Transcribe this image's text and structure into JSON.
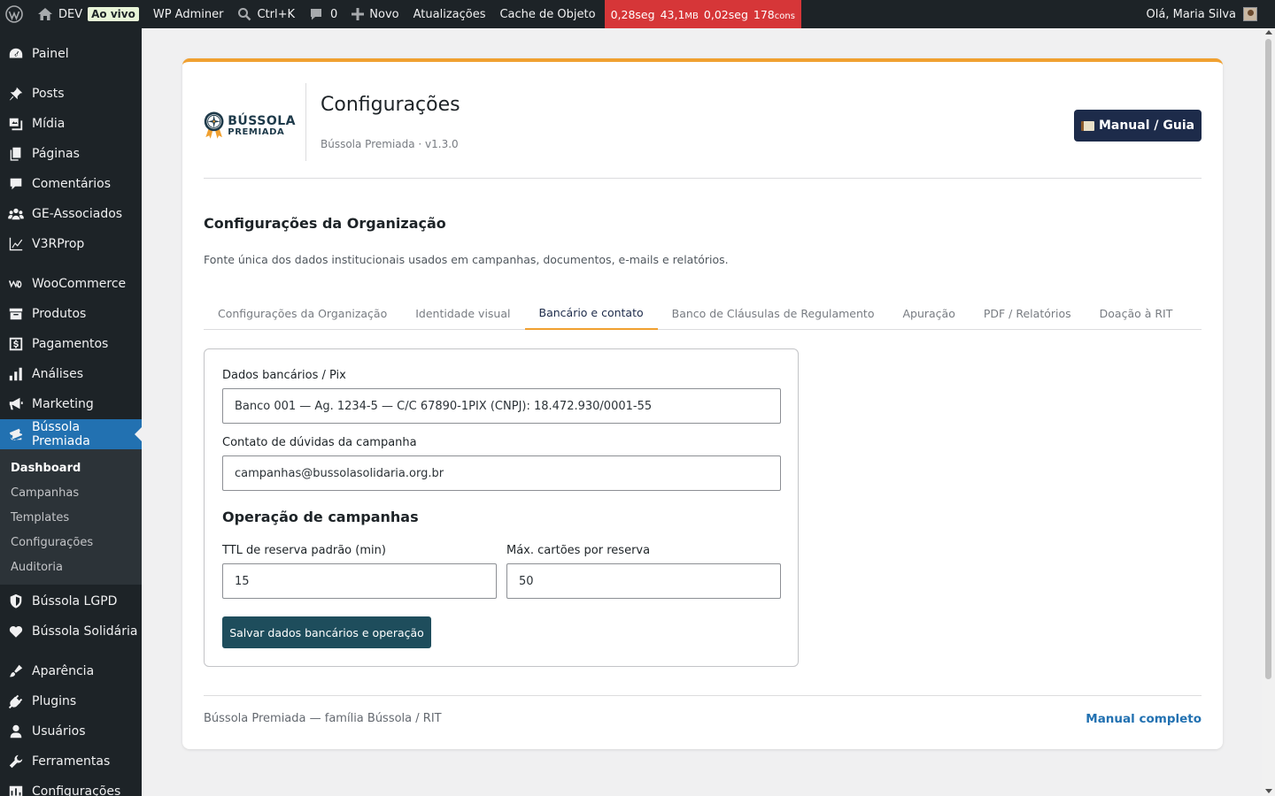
{
  "admin_bar": {
    "site_name": "DEV",
    "live_badge": "Ao vivo",
    "wp_adminer": "WP Adminer",
    "search_shortcut": "Ctrl+K",
    "comments_count": "0",
    "new_label": "Novo",
    "updates_label": "Atualizações",
    "cache_label": "Cache de Objeto",
    "perf": {
      "time1": "0,28seg",
      "mem": "43,1",
      "mem_unit": "MB",
      "time2": "0,02seg",
      "queries": "178",
      "queries_unit": "cons"
    },
    "greeting": "Olá, Maria Silva"
  },
  "sidebar": {
    "items": [
      {
        "label": "Painel",
        "icon": "dashboard-icon"
      },
      {
        "label": "Posts",
        "icon": "pin-icon"
      },
      {
        "label": "Mídia",
        "icon": "media-icon"
      },
      {
        "label": "Páginas",
        "icon": "pages-icon"
      },
      {
        "label": "Comentários",
        "icon": "comments-icon"
      },
      {
        "label": "GE-Associados",
        "icon": "groups-icon"
      },
      {
        "label": "V3RProp",
        "icon": "chart-line-icon"
      },
      {
        "label": "WooCommerce",
        "icon": "woocommerce-icon"
      },
      {
        "label": "Produtos",
        "icon": "archive-icon"
      },
      {
        "label": "Pagamentos",
        "icon": "payments-icon"
      },
      {
        "label": "Análises",
        "icon": "bar-chart-icon"
      },
      {
        "label": "Marketing",
        "icon": "megaphone-icon"
      },
      {
        "label": "Bússola Premiada",
        "icon": "tickets-icon"
      },
      {
        "label": "Bússola LGPD",
        "icon": "shield-icon"
      },
      {
        "label": "Bússola Solidária",
        "icon": "heart-icon"
      },
      {
        "label": "Aparência",
        "icon": "brush-icon"
      },
      {
        "label": "Plugins",
        "icon": "plugin-icon"
      },
      {
        "label": "Usuários",
        "icon": "user-icon"
      },
      {
        "label": "Ferramentas",
        "icon": "wrench-icon"
      },
      {
        "label": "Configurações",
        "icon": "settings-icon"
      }
    ],
    "submenu": [
      "Dashboard",
      "Campanhas",
      "Templates",
      "Configurações",
      "Auditoria"
    ]
  },
  "header": {
    "logo_line1": "BÚSSOLA",
    "logo_line2": "PREMIADA",
    "title": "Configurações",
    "version": "Bússola Premiada · v1.3.0",
    "manual_button": "Manual / Guia"
  },
  "section": {
    "title": "Configurações da Organização",
    "description": "Fonte única dos dados institucionais usados em campanhas, documentos, e-mails e relatórios."
  },
  "tabs": [
    "Configurações da Organização",
    "Identidade visual",
    "Bancário e contato",
    "Banco de Cláusulas de Regulamento",
    "Apuração",
    "PDF / Relatórios",
    "Doação à RIT"
  ],
  "active_tab": "Bancário e contato",
  "form": {
    "bank_label": "Dados bancários / Pix",
    "bank_value": "Banco 001 — Ag. 1234-5 — C/C 67890-1PIX (CNPJ): 18.472.930/0001-55",
    "contact_label": "Contato de dúvidas da campanha",
    "contact_value": "campanhas@bussolasolidaria.org.br",
    "ops_title": "Operação de campanhas",
    "ttl_label": "TTL de reserva padrão (min)",
    "ttl_value": "15",
    "max_label": "Máx. cartões por reserva",
    "max_value": "50",
    "save_button": "Salvar dados bancários e operação"
  },
  "footer": {
    "left": "Bússola Premiada — família Bússola / RIT",
    "right": "Manual completo"
  },
  "colors": {
    "admin_bar": "#1d2327",
    "accent_orange": "#f0a030",
    "active_menu": "#2271b1",
    "navy_button": "#1d2b4a",
    "teal_button": "#1e4d5c",
    "perf_red": "#d63638"
  }
}
